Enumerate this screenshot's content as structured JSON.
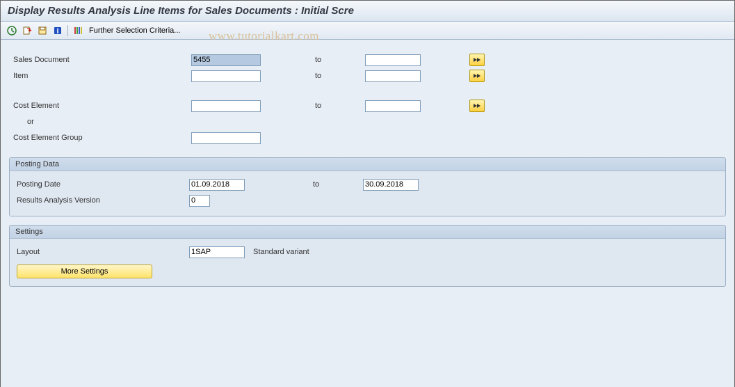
{
  "title": "Display Results Analysis Line Items for Sales Documents : Initial Scre",
  "watermark": "www.tutorialkart.com",
  "toolbar": {
    "further_label": "Further Selection Criteria..."
  },
  "fields": {
    "sales_document": {
      "label": "Sales Document",
      "from": "5455",
      "to_label": "to",
      "to": ""
    },
    "item": {
      "label": "Item",
      "from": "",
      "to_label": "to",
      "to": ""
    },
    "cost_element": {
      "label": "Cost Element",
      "from": "",
      "to_label": "to",
      "to": ""
    },
    "or_label": "or",
    "cost_element_group": {
      "label": "Cost Element Group",
      "value": ""
    }
  },
  "posting": {
    "group_title": "Posting Data",
    "date": {
      "label": "Posting Date",
      "from": "01.09.2018",
      "to_label": "to",
      "to": "30.09.2018"
    },
    "ra_version": {
      "label": "Results Analysis Version",
      "value": "0"
    }
  },
  "settings": {
    "group_title": "Settings",
    "layout": {
      "label": "Layout",
      "value": "1SAP",
      "variant_text": "Standard variant"
    },
    "more_button": "More Settings"
  }
}
